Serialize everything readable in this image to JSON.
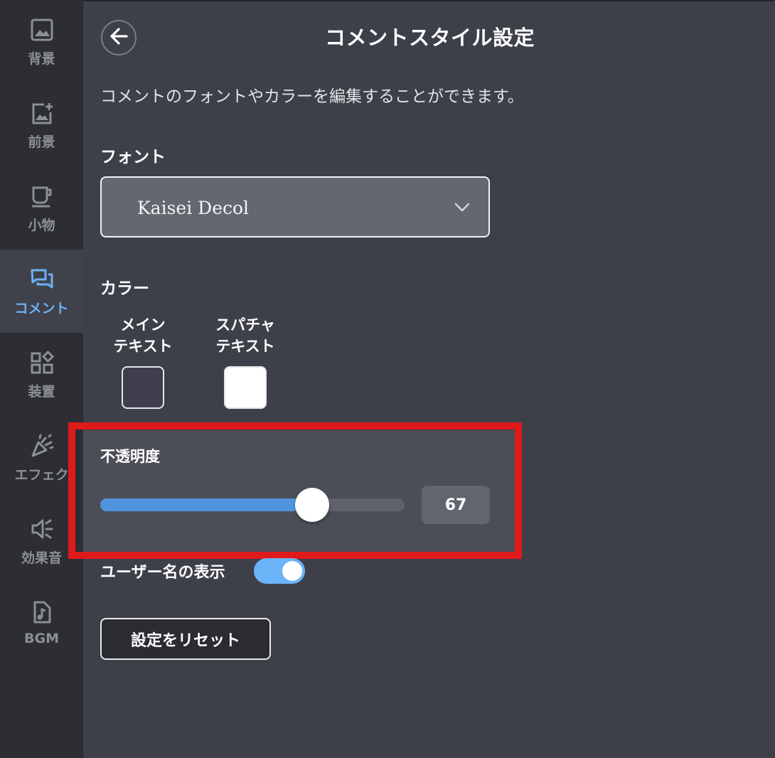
{
  "sidebar": {
    "items": [
      {
        "label": "背景",
        "icon": "image-icon"
      },
      {
        "label": "前景",
        "icon": "image-add-icon"
      },
      {
        "label": "小物",
        "icon": "cup-icon"
      },
      {
        "label": "コメント",
        "icon": "chat-icon",
        "active": true
      },
      {
        "label": "装置",
        "icon": "widgets-icon"
      },
      {
        "label": "エフェク",
        "icon": "party-popper-icon"
      },
      {
        "label": "効果音",
        "icon": "speaker-icon"
      },
      {
        "label": "BGM",
        "icon": "music-file-icon"
      }
    ]
  },
  "header": {
    "title": "コメントスタイル設定"
  },
  "description": "コメントのフォントやカラーを編集することができます。",
  "font": {
    "label": "フォント",
    "selected": "Kaisei Decol"
  },
  "color": {
    "label": "カラー",
    "main": {
      "label": "メイン\nテキスト",
      "value": "#3f3e4e"
    },
    "superchat": {
      "label": "スパチャ\nテキスト",
      "value": "#ffffff"
    }
  },
  "opacity": {
    "label": "不透明度",
    "value": 67,
    "display": "67",
    "min": 0,
    "max": 100,
    "fill_color": "#5094de",
    "highlight_color": "#e01a1a"
  },
  "username_display": {
    "label": "ユーザー名の表示",
    "enabled": true
  },
  "reset_button": "設定をリセット",
  "colors": {
    "background": "#3e4049",
    "sidebar": "#2c2e34",
    "accent": "#6db0f5"
  }
}
